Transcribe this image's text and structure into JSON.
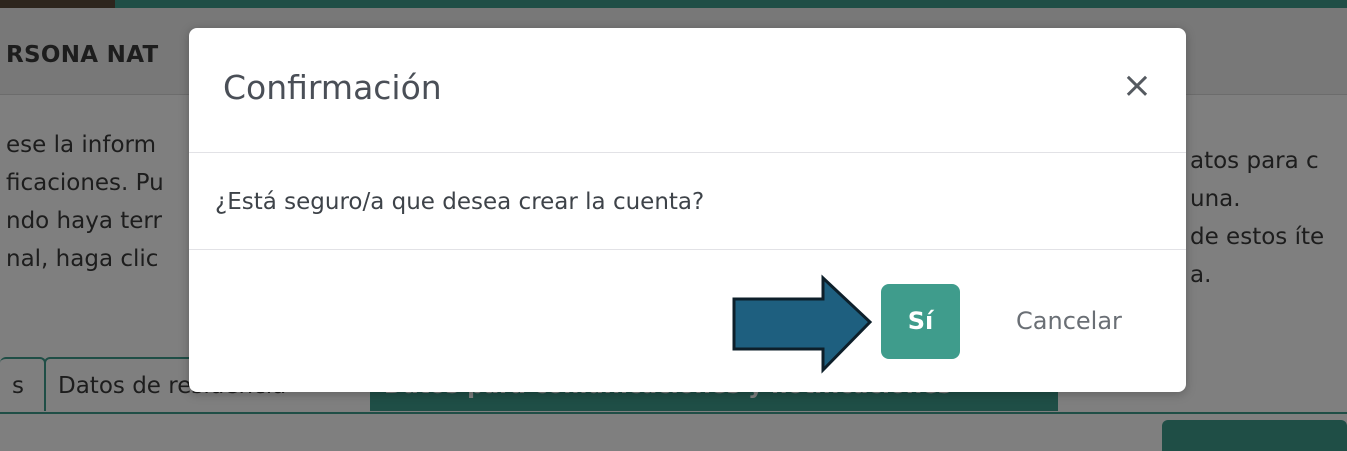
{
  "background": {
    "section_title": "RSONA NAT",
    "paragraph_left": [
      "ese la inform",
      "ficaciones. Pu",
      "ndo haya terr",
      "nal, haga clic"
    ],
    "paragraph_right": [
      "atos para c",
      "una.",
      "de estos íte",
      "a."
    ],
    "tabs": [
      {
        "label": "s"
      },
      {
        "label": "Datos de residencia"
      },
      {
        "label": "Datos para comunicaciones y notificaciones"
      }
    ]
  },
  "modal": {
    "title": "Confirmación",
    "close_glyph": "×",
    "message": "¿Está seguro/a que desea crear la cuenta?",
    "confirm_label": "Sí",
    "cancel_label": "Cancelar"
  },
  "annotation": {
    "arrow_color": "#1e5f7f",
    "points_to": "confirm-button"
  },
  "colors": {
    "accent": "#3f9c8c",
    "overlay": "rgba(0,0,0,0.5)"
  }
}
